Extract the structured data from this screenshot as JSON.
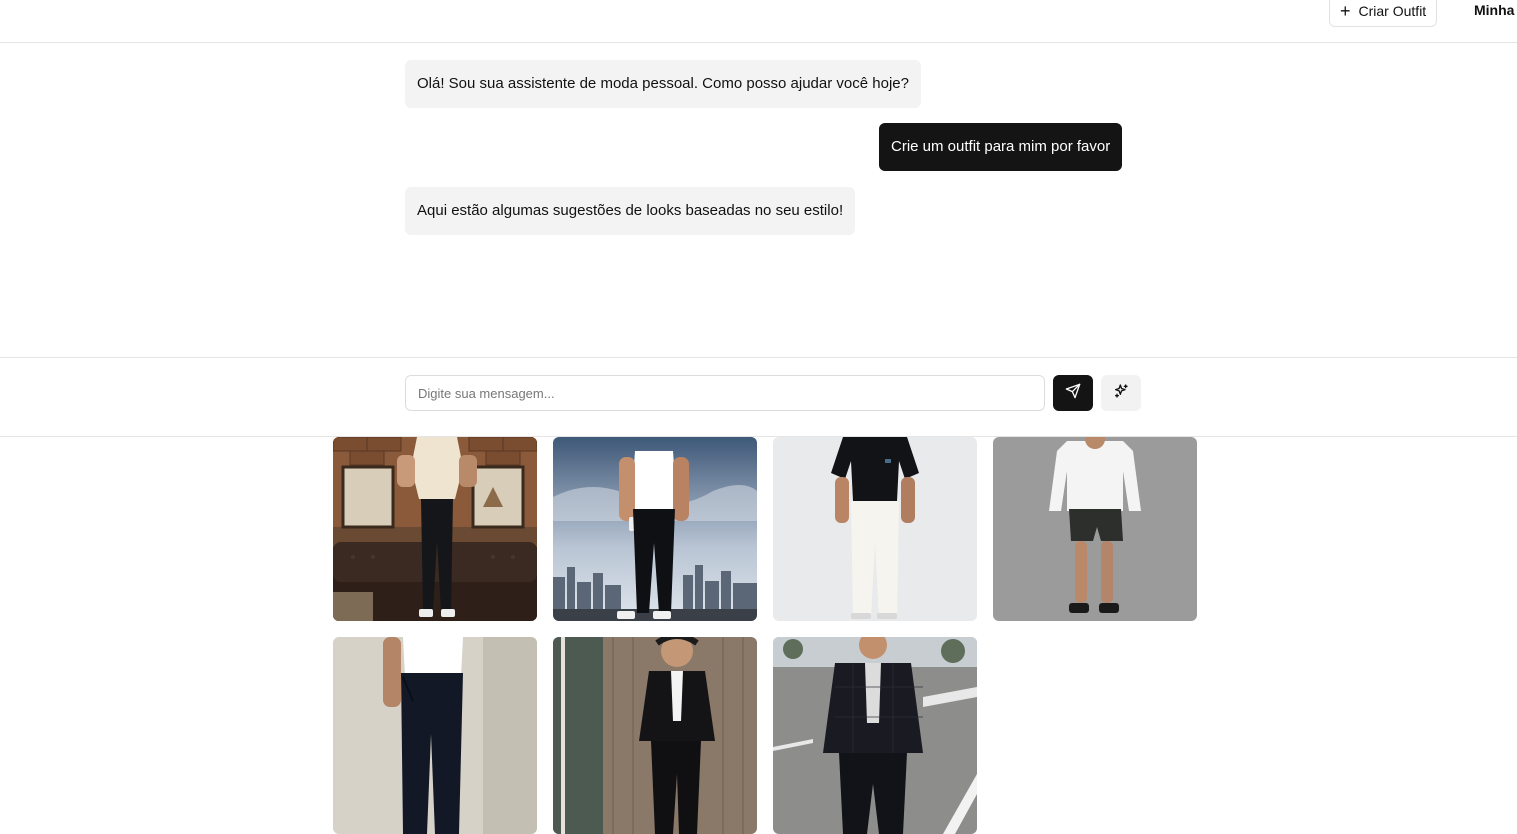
{
  "header": {
    "create_outfit_label": "Criar Outfit",
    "nav_label": "Minha"
  },
  "chat": {
    "messages": [
      {
        "role": "assistant",
        "text": "Olá! Sou sua assistente de moda pessoal. Como posso ajudar você hoje?"
      },
      {
        "role": "user",
        "text": "Crie um outfit para mim por favor"
      },
      {
        "role": "assistant",
        "text": "Aqui estão algumas sugestões de looks baseadas no seu estilo!"
      }
    ]
  },
  "composer": {
    "placeholder": "Digite sua mensagem...",
    "send_icon": "send-icon",
    "magic_icon": "sparkles-icon"
  },
  "outfits": [
    {
      "name": "outfit-beige-polo-black-jeans"
    },
    {
      "name": "outfit-white-tank-black-jeans"
    },
    {
      "name": "outfit-black-tee-white-pants"
    },
    {
      "name": "outfit-white-longsleeve-shorts"
    },
    {
      "name": "outfit-white-tee-navy-trousers"
    },
    {
      "name": "outfit-black-blazer-white-tee"
    },
    {
      "name": "outfit-plaid-blazer-street"
    }
  ]
}
